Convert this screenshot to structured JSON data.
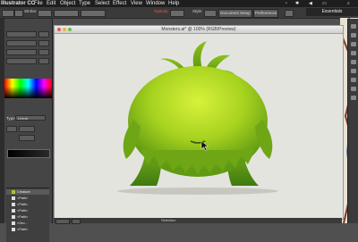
{
  "menubar": {
    "app_name": "Illustrator CC",
    "items": [
      "File",
      "Edit",
      "Object",
      "Type",
      "Select",
      "Effect",
      "View",
      "Window",
      "Help"
    ]
  },
  "toolbar": {
    "stroke_label": "Stroke:",
    "opacity_label": "Opacity:",
    "style_label": "Style:",
    "document_setup_label": "Document Setup",
    "preferences_label": "Preferences",
    "workspace_label": "Essentials"
  },
  "panel": {
    "type_label": "Type",
    "type_value": "Linear"
  },
  "layers": [
    {
      "label": "Creature"
    },
    {
      "label": "<Path>"
    },
    {
      "label": "<Path>"
    },
    {
      "label": "<Path>"
    },
    {
      "label": "<Path>"
    },
    {
      "label": "<Gro..."
    },
    {
      "label": "<Path>"
    }
  ],
  "document": {
    "title": "Monsters.ai* @ 100% (RGB/Preview)"
  },
  "statusbar": {
    "tool_label": "Selection"
  },
  "colors": {
    "monster_light": "#d8f23a",
    "monster_mid": "#8ec21a",
    "monster_dark": "#3f7a10",
    "canvas_bg": "#e4e4df"
  }
}
